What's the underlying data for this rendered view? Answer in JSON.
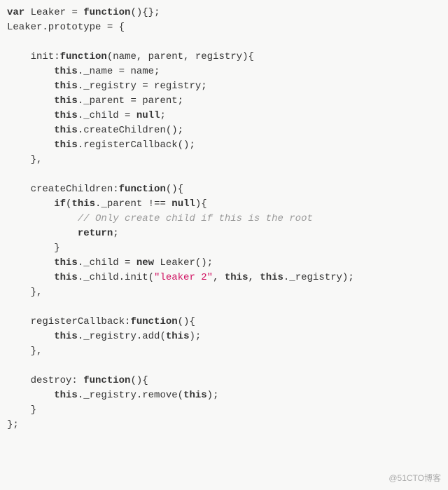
{
  "code": {
    "tokens": [
      [
        [
          "kw",
          "var"
        ],
        [
          "punc",
          " Leaker "
        ],
        [
          "op",
          "="
        ],
        [
          "punc",
          " "
        ],
        [
          "kw",
          "function"
        ],
        [
          "punc",
          "(){};"
        ]
      ],
      [
        [
          "punc",
          "Leaker.prototype "
        ],
        [
          "op",
          "="
        ],
        [
          "punc",
          " {"
        ]
      ],
      [],
      [
        [
          "punc",
          "    init:"
        ],
        [
          "kw",
          "function"
        ],
        [
          "punc",
          "(name, parent, registry){"
        ]
      ],
      [
        [
          "punc",
          "        "
        ],
        [
          "kw",
          "this"
        ],
        [
          "punc",
          "._name "
        ],
        [
          "op",
          "="
        ],
        [
          "punc",
          " name;"
        ]
      ],
      [
        [
          "punc",
          "        "
        ],
        [
          "kw",
          "this"
        ],
        [
          "punc",
          "._registry "
        ],
        [
          "op",
          "="
        ],
        [
          "punc",
          " registry;"
        ]
      ],
      [
        [
          "punc",
          "        "
        ],
        [
          "kw",
          "this"
        ],
        [
          "punc",
          "._parent "
        ],
        [
          "op",
          "="
        ],
        [
          "punc",
          " parent;"
        ]
      ],
      [
        [
          "punc",
          "        "
        ],
        [
          "kw",
          "this"
        ],
        [
          "punc",
          "._child "
        ],
        [
          "op",
          "="
        ],
        [
          "punc",
          " "
        ],
        [
          "null",
          "null"
        ],
        [
          "punc",
          ";"
        ]
      ],
      [
        [
          "punc",
          "        "
        ],
        [
          "kw",
          "this"
        ],
        [
          "punc",
          ".createChildren();"
        ]
      ],
      [
        [
          "punc",
          "        "
        ],
        [
          "kw",
          "this"
        ],
        [
          "punc",
          ".registerCallback();"
        ]
      ],
      [
        [
          "punc",
          "    },"
        ]
      ],
      [],
      [
        [
          "punc",
          "    createChildren:"
        ],
        [
          "kw",
          "function"
        ],
        [
          "punc",
          "(){"
        ]
      ],
      [
        [
          "punc",
          "        "
        ],
        [
          "kw",
          "if"
        ],
        [
          "punc",
          "("
        ],
        [
          "kw",
          "this"
        ],
        [
          "punc",
          "._parent "
        ],
        [
          "op",
          "!=="
        ],
        [
          "punc",
          " "
        ],
        [
          "null",
          "null"
        ],
        [
          "punc",
          "){"
        ]
      ],
      [
        [
          "punc",
          "            "
        ],
        [
          "cmt",
          "// Only create child if this is the root"
        ]
      ],
      [
        [
          "punc",
          "            "
        ],
        [
          "kw",
          "return"
        ],
        [
          "punc",
          ";"
        ]
      ],
      [
        [
          "punc",
          "        }"
        ]
      ],
      [
        [
          "punc",
          "        "
        ],
        [
          "kw",
          "this"
        ],
        [
          "punc",
          "._child "
        ],
        [
          "op",
          "="
        ],
        [
          "punc",
          " "
        ],
        [
          "kw",
          "new"
        ],
        [
          "punc",
          " Leaker();"
        ]
      ],
      [
        [
          "punc",
          "        "
        ],
        [
          "kw",
          "this"
        ],
        [
          "punc",
          "._child.init("
        ],
        [
          "str",
          "\"leaker 2\""
        ],
        [
          "punc",
          ", "
        ],
        [
          "kw",
          "this"
        ],
        [
          "punc",
          ", "
        ],
        [
          "kw",
          "this"
        ],
        [
          "punc",
          "._registry);"
        ]
      ],
      [
        [
          "punc",
          "    },"
        ]
      ],
      [],
      [
        [
          "punc",
          "    registerCallback:"
        ],
        [
          "kw",
          "function"
        ],
        [
          "punc",
          "(){"
        ]
      ],
      [
        [
          "punc",
          "        "
        ],
        [
          "kw",
          "this"
        ],
        [
          "punc",
          "._registry.add("
        ],
        [
          "kw",
          "this"
        ],
        [
          "punc",
          ");"
        ]
      ],
      [
        [
          "punc",
          "    },"
        ]
      ],
      [],
      [
        [
          "punc",
          "    destroy: "
        ],
        [
          "kw",
          "function"
        ],
        [
          "punc",
          "(){"
        ]
      ],
      [
        [
          "punc",
          "        "
        ],
        [
          "kw",
          "this"
        ],
        [
          "punc",
          "._registry.remove("
        ],
        [
          "kw",
          "this"
        ],
        [
          "punc",
          ");"
        ]
      ],
      [
        [
          "punc",
          "    }"
        ]
      ],
      [
        [
          "punc",
          "};"
        ]
      ]
    ],
    "plain_text": "var Leaker = function(){};\nLeaker.prototype = {\n\n    init:function(name, parent, registry){\n        this._name = name;\n        this._registry = registry;\n        this._parent = parent;\n        this._child = null;\n        this.createChildren();\n        this.registerCallback();\n    },\n\n    createChildren:function(){\n        if(this._parent !== null){\n            // Only create child if this is the root\n            return;\n        }\n        this._child = new Leaker();\n        this._child.init(\"leaker 2\", this, this._registry);\n    },\n\n    registerCallback:function(){\n        this._registry.add(this);\n    },\n\n    destroy: function(){\n        this._registry.remove(this);\n    }\n};"
  },
  "watermark": "@51CTO博客"
}
